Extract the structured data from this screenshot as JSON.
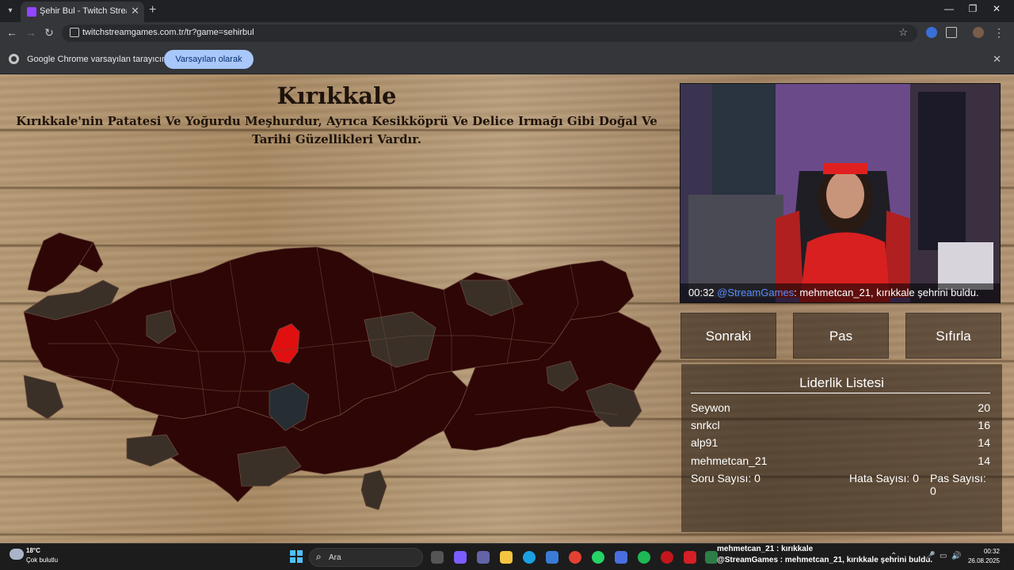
{
  "browser": {
    "tab_title": "Şehir Bul - Twitch Stream Games",
    "url": "twitchstreamgames.com.tr/tr?game=sehirbul",
    "infobar_text": "Google Chrome varsayılan tarayıcınız değil",
    "infobar_button": "Varsayılan olarak ayarla"
  },
  "game": {
    "city": "Kırıkkale",
    "description": "Kırıkkale'nin Patatesi Ve Yoğurdu Meşhurdur, Ayrıca Kesikköprü Ve Delice Irmağı Gibi Doğal Ve Tarihi Güzellikleri Vardır.",
    "chat": {
      "time": "00:32",
      "mention": "@StreamGames",
      "message": ": mehmetcan_21, kırıkkale şehrini buldu."
    },
    "buttons": {
      "next": "Sonraki",
      "pass": "Pas",
      "reset": "Sıfırla"
    },
    "leaderboard": {
      "title": "Liderlik Listesi",
      "rows": [
        {
          "name": "Seywon",
          "score": "20"
        },
        {
          "name": "snrkcl",
          "score": "16"
        },
        {
          "name": "alp91",
          "score": "14"
        },
        {
          "name": "mehmetcan_21",
          "score": "14"
        }
      ],
      "stats": {
        "questions": "Soru Sayısı: 0",
        "errors": "Hata Sayısı: 0",
        "passes": "Pas Sayısı: 0"
      }
    },
    "colors": {
      "province": "#2e0606",
      "highlight": "#e01010",
      "water": "#3a3028"
    }
  },
  "taskbar": {
    "weather_temp": "18°C",
    "weather_desc": "Çok bulutlu",
    "search_label": "Ara",
    "chat_line1": "mehmetcan_21 : kırıkkale",
    "chat_line2": "@StreamGames : mehmetcan_21, kırıkkale şehrini buldu.",
    "time": "00:32",
    "date": "26.08.2025"
  }
}
